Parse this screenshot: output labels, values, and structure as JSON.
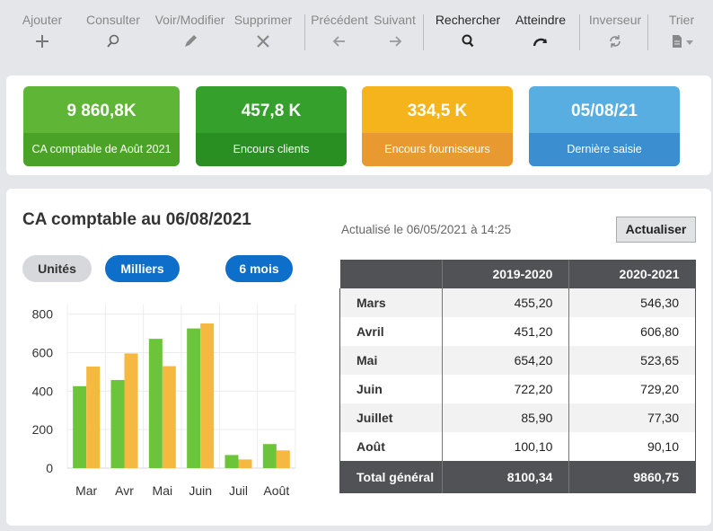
{
  "toolbar": {
    "ajouter": "Ajouter",
    "consulter": "Consulter",
    "voir_modifier": "Voir/Modifier",
    "supprimer": "Supprimer",
    "precedent": "Précédent",
    "suivant": "Suivant",
    "rechercher": "Rechercher",
    "atteindre": "Atteindre",
    "inverseur": "Inverseur",
    "trier": "Trier"
  },
  "kpis": [
    {
      "value": "9 860,8K",
      "label": "CA comptable de Août 2021",
      "color": "#5fb535"
    },
    {
      "value": "457,8 K",
      "label": "Encours clients",
      "color": "#36a02c"
    },
    {
      "value": "334,5 K",
      "label": "Encours fournisseurs",
      "color": "#f5b41c"
    },
    {
      "value": "05/08/21",
      "label": "Dernière saisie",
      "color": "#58aee0"
    }
  ],
  "main": {
    "title": "CA comptable au 06/08/2021",
    "updated": "Actualisé le 06/05/2021 à 14:25",
    "refresh_label": "Actualiser",
    "unit_buttons": [
      "Unités",
      "Milliers"
    ],
    "period_button": "6 mois"
  },
  "chart_data": {
    "type": "bar",
    "categories": [
      "Mar",
      "Avr",
      "Mai",
      "Juin",
      "Juil",
      "Août"
    ],
    "series": [
      {
        "values": [
          426,
          458,
          672,
          726,
          68,
          125
        ],
        "color": "#6cc43b"
      },
      {
        "values": [
          528,
          596,
          530,
          752,
          45,
          92
        ],
        "color": "#f5b942"
      }
    ],
    "yticks": [
      0,
      200,
      400,
      600,
      800
    ],
    "ylim": [
      0,
      850
    ],
    "grid": true
  },
  "table": {
    "headers": [
      "",
      "2019-2020",
      "2020-2021"
    ],
    "rows": [
      [
        "Mars",
        "455,20",
        "546,30"
      ],
      [
        "Avril",
        "451,20",
        "606,80"
      ],
      [
        "Mai",
        "654,20",
        "523,65"
      ],
      [
        "Juin",
        "722,20",
        "729,20"
      ],
      [
        "Juillet",
        "85,90",
        "77,30"
      ],
      [
        "Août",
        "100,10",
        "90,10"
      ]
    ],
    "total": [
      "Total général",
      "8100,34",
      "9860,75"
    ]
  }
}
